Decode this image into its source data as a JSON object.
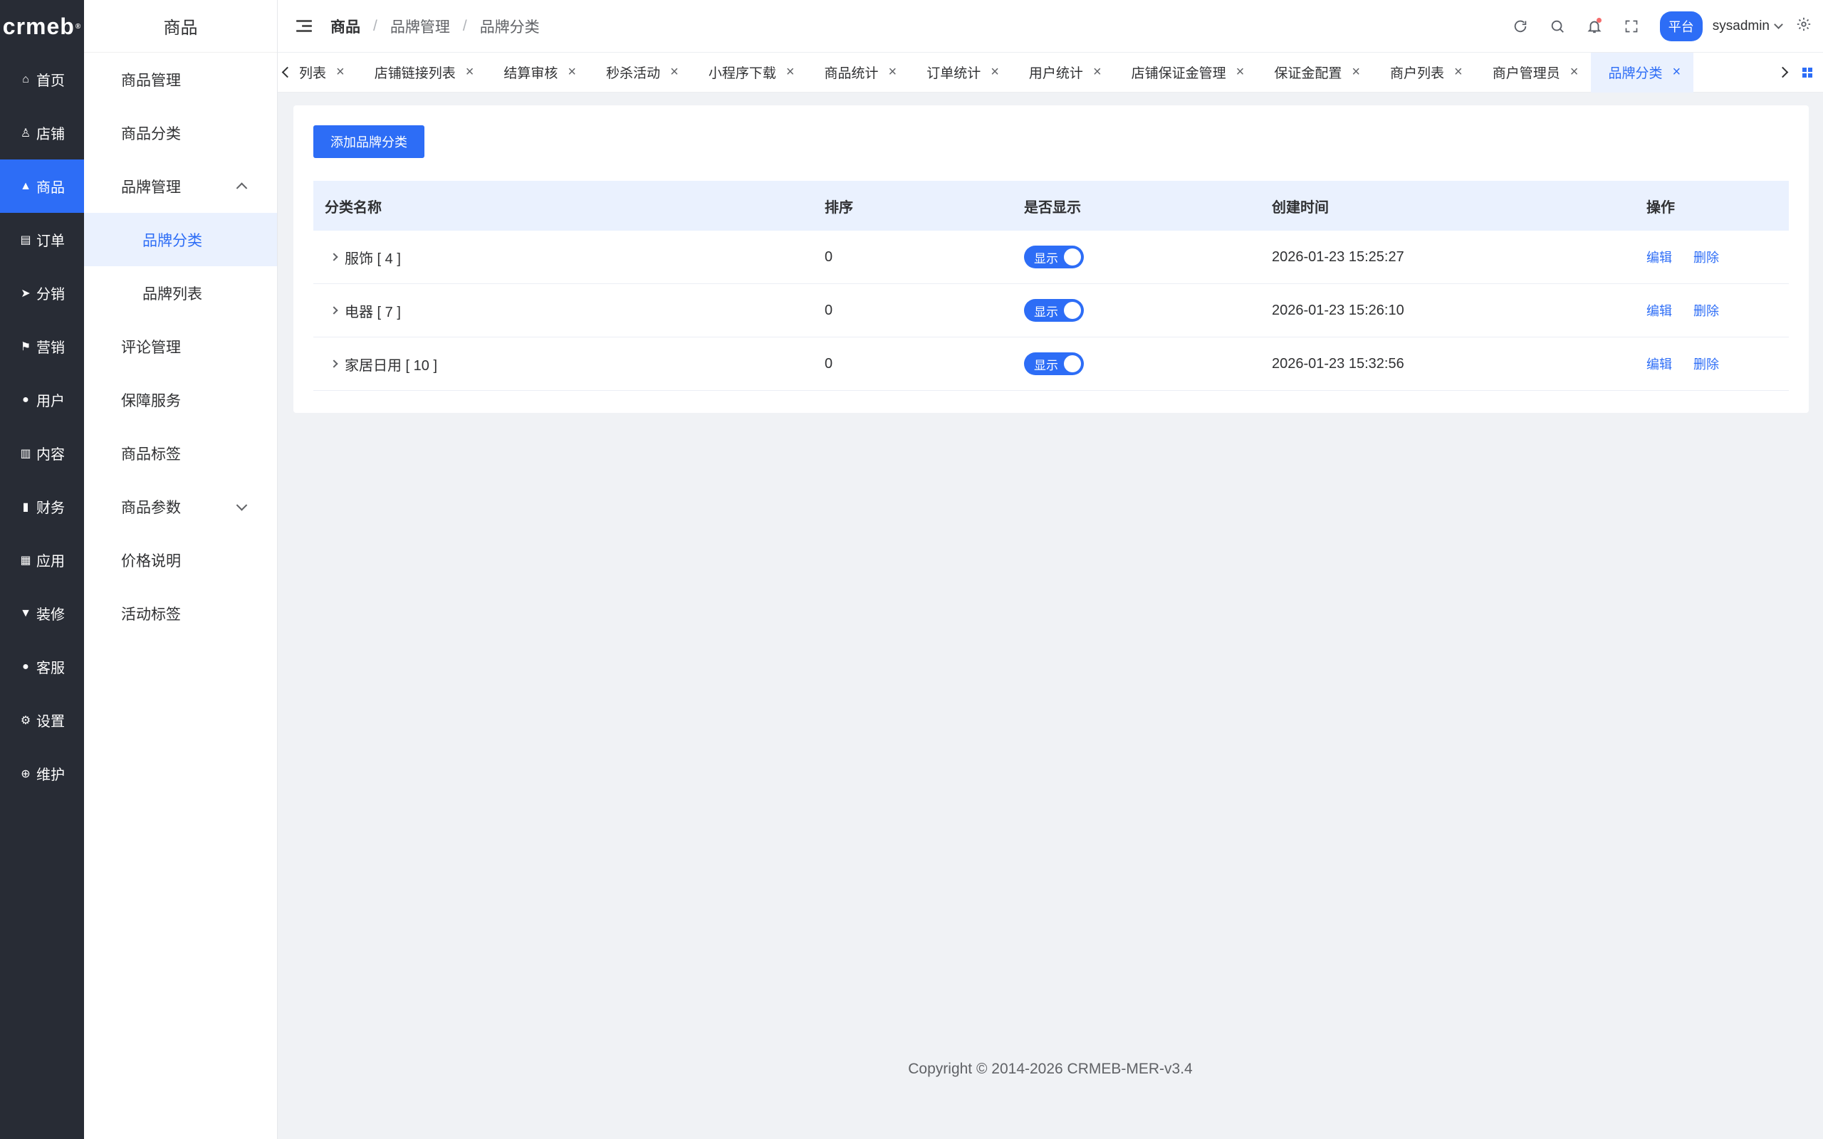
{
  "logo": "crmeb",
  "logo_mark": "®",
  "rail": [
    {
      "label": "首页",
      "icon": "home-icon",
      "glyph": "⌂"
    },
    {
      "label": "店铺",
      "icon": "store-icon",
      "glyph": "♙"
    },
    {
      "label": "商品",
      "icon": "goods-bag-icon",
      "glyph": "▲"
    },
    {
      "label": "订单",
      "icon": "order-icon",
      "glyph": "▤"
    },
    {
      "label": "分销",
      "icon": "send-icon",
      "glyph": "➤"
    },
    {
      "label": "营销",
      "icon": "flag-icon",
      "glyph": "⚑"
    },
    {
      "label": "用户",
      "icon": "user-icon",
      "glyph": "●"
    },
    {
      "label": "内容",
      "icon": "book-icon",
      "glyph": "▥"
    },
    {
      "label": "财务",
      "icon": "bar-chart-icon",
      "glyph": "▮"
    },
    {
      "label": "应用",
      "icon": "apps-grid-icon",
      "glyph": "▦"
    },
    {
      "label": "装修",
      "icon": "brush-icon",
      "glyph": "▼"
    },
    {
      "label": "客服",
      "icon": "service-icon",
      "glyph": "●"
    },
    {
      "label": "设置",
      "icon": "gear-icon",
      "glyph": "⚙"
    },
    {
      "label": "维护",
      "icon": "maintenance-icon",
      "glyph": "⊕"
    }
  ],
  "sidebar": {
    "title": "商品",
    "items": [
      {
        "label": "商品管理"
      },
      {
        "label": "商品分类"
      },
      {
        "label": "品牌管理"
      },
      {
        "label": "品牌分类"
      },
      {
        "label": "品牌列表"
      },
      {
        "label": "评论管理"
      },
      {
        "label": "保障服务"
      },
      {
        "label": "商品标签"
      },
      {
        "label": "商品参数"
      },
      {
        "label": "价格说明"
      },
      {
        "label": "活动标签"
      }
    ]
  },
  "header": {
    "breadcrumb": [
      "商品",
      "品牌管理",
      "品牌分类"
    ],
    "separator": "/",
    "platform_badge": "平台",
    "username": "sysadmin"
  },
  "tabs": [
    {
      "label": "列表"
    },
    {
      "label": "店铺链接列表"
    },
    {
      "label": "结算审核"
    },
    {
      "label": "秒杀活动"
    },
    {
      "label": "小程序下载"
    },
    {
      "label": "商品统计"
    },
    {
      "label": "订单统计"
    },
    {
      "label": "用户统计"
    },
    {
      "label": "店铺保证金管理"
    },
    {
      "label": "保证金配置"
    },
    {
      "label": "商户列表"
    },
    {
      "label": "商户管理员"
    },
    {
      "label": "品牌分类"
    }
  ],
  "tab_close": "×",
  "content": {
    "add_button": "添加品牌分类",
    "columns": [
      "分类名称",
      "排序",
      "是否显示",
      "创建时间",
      "操作"
    ],
    "rows": [
      {
        "name": "服饰 [ 4 ]",
        "sort": "0",
        "show": "显示",
        "created": "2026-01-23 15:25:27",
        "edit": "编辑",
        "delete": "删除"
      },
      {
        "name": "电器 [ 7 ]",
        "sort": "0",
        "show": "显示",
        "created": "2026-01-23 15:26:10",
        "edit": "编辑",
        "delete": "删除"
      },
      {
        "name": "家居日用 [ 10 ]",
        "sort": "0",
        "show": "显示",
        "created": "2026-01-23 15:32:56",
        "edit": "编辑",
        "delete": "删除"
      }
    ]
  },
  "footer": "Copyright © 2014-2026 CRMEB-MER-v3.4",
  "colors": {
    "accent": "#2d6df6",
    "rail_bg": "#282c35",
    "page_bg": "#f0f2f5",
    "header_row_bg": "#eaf1fe"
  }
}
